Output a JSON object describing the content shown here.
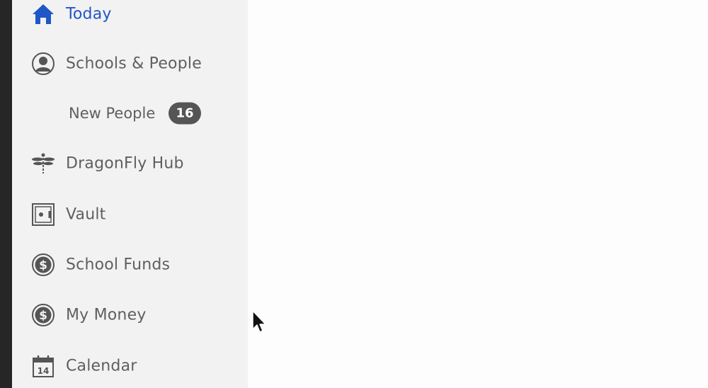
{
  "sidebar": {
    "items": [
      {
        "label": "Today",
        "icon": "home-icon",
        "active": true
      },
      {
        "label": "Schools & People",
        "icon": "user-circle-icon"
      },
      {
        "label": "New People",
        "badge": "16",
        "sub": true
      },
      {
        "label": "DragonFly Hub",
        "icon": "dragonfly-icon"
      },
      {
        "label": "Vault",
        "icon": "safe-icon"
      },
      {
        "label": "School Funds",
        "icon": "dollar-coin-icon"
      },
      {
        "label": "My Money",
        "icon": "dollar-coin-icon"
      },
      {
        "label": "Calendar",
        "icon": "calendar-icon",
        "icon_text": "14"
      }
    ]
  },
  "colors": {
    "active": "#1f56c8",
    "text": "#5f5f5f",
    "sidebar_bg": "#f2f2f2",
    "badge_bg": "#555555"
  }
}
